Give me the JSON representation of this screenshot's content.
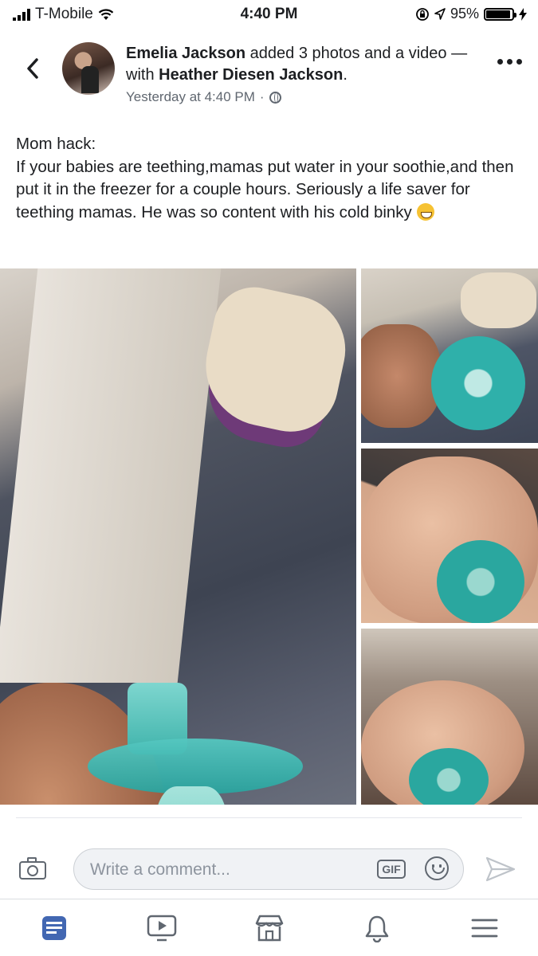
{
  "status_bar": {
    "carrier": "T-Mobile",
    "time": "4:40 PM",
    "battery": "95%",
    "battery_level": 0.95
  },
  "post": {
    "author": "Emelia Jackson",
    "action": "added 3 photos and a video — with",
    "tagged": "Heather Diesen Jackson",
    "timestamp": "Yesterday at 4:40 PM",
    "privacy_icon": "globe-icon",
    "text_lines": [
      "Mom hack:",
      "If your babies are teething,mamas put water in your soothie,and then put it in the freezer for a couple hours. Seriously a life saver for teething mamas. He was so content with his cold binky"
    ],
    "emoji": "grinning-sweat-emoji"
  },
  "comment_bar": {
    "placeholder": "Write a comment...",
    "gif_label": "GIF"
  },
  "tabs": [
    {
      "name": "news-feed",
      "icon": "news-feed-icon",
      "active": true
    },
    {
      "name": "watch",
      "icon": "video-icon",
      "active": false
    },
    {
      "name": "marketplace",
      "icon": "marketplace-icon",
      "active": false
    },
    {
      "name": "notifications",
      "icon": "bell-icon",
      "active": false
    },
    {
      "name": "menu",
      "icon": "menu-icon",
      "active": false
    }
  ],
  "colors": {
    "facebook_blue": "#4267b2",
    "icon_gray": "#606770",
    "text_primary": "#1c1e21",
    "text_secondary": "#606770"
  }
}
